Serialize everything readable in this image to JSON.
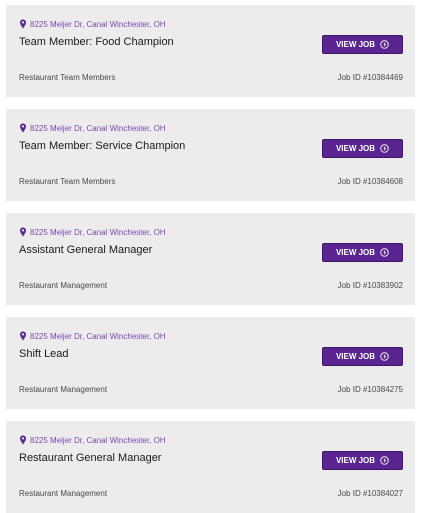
{
  "colors": {
    "accent": "#5a2590",
    "location_text": "#7a47b0",
    "card_bg": "#ececec"
  },
  "icons": {
    "location": "map-pin-icon",
    "button": "circle-arrow-right-icon"
  },
  "jobs": [
    {
      "location": "8225 Meijer Dr, Canal Winchester, OH",
      "title": "Team Member: Food Champion",
      "button_label": "VIEW JOB",
      "category": "Restaurant Team Members",
      "job_id": "Job ID #10384469"
    },
    {
      "location": "8225 Meijer Dr, Canal Winchester, OH",
      "title": "Team Member: Service Champion",
      "button_label": "VIEW JOB",
      "category": "Restaurant Team Members",
      "job_id": "Job ID #10384608"
    },
    {
      "location": "8225 Meijer Dr, Canal Winchester, OH",
      "title": "Assistant General Manager",
      "button_label": "VIEW JOB",
      "category": "Restaurant Management",
      "job_id": "Job ID #10383902"
    },
    {
      "location": "8225 Meijer Dr, Canal Winchester, OH",
      "title": "Shift Lead",
      "button_label": "VIEW JOB",
      "category": "Restaurant Management",
      "job_id": "Job ID #10384275"
    },
    {
      "location": "8225 Meijer Dr, Canal Winchester, OH",
      "title": "Restaurant General Manager",
      "button_label": "VIEW JOB",
      "category": "Restaurant Management",
      "job_id": "Job ID #10384027"
    }
  ]
}
